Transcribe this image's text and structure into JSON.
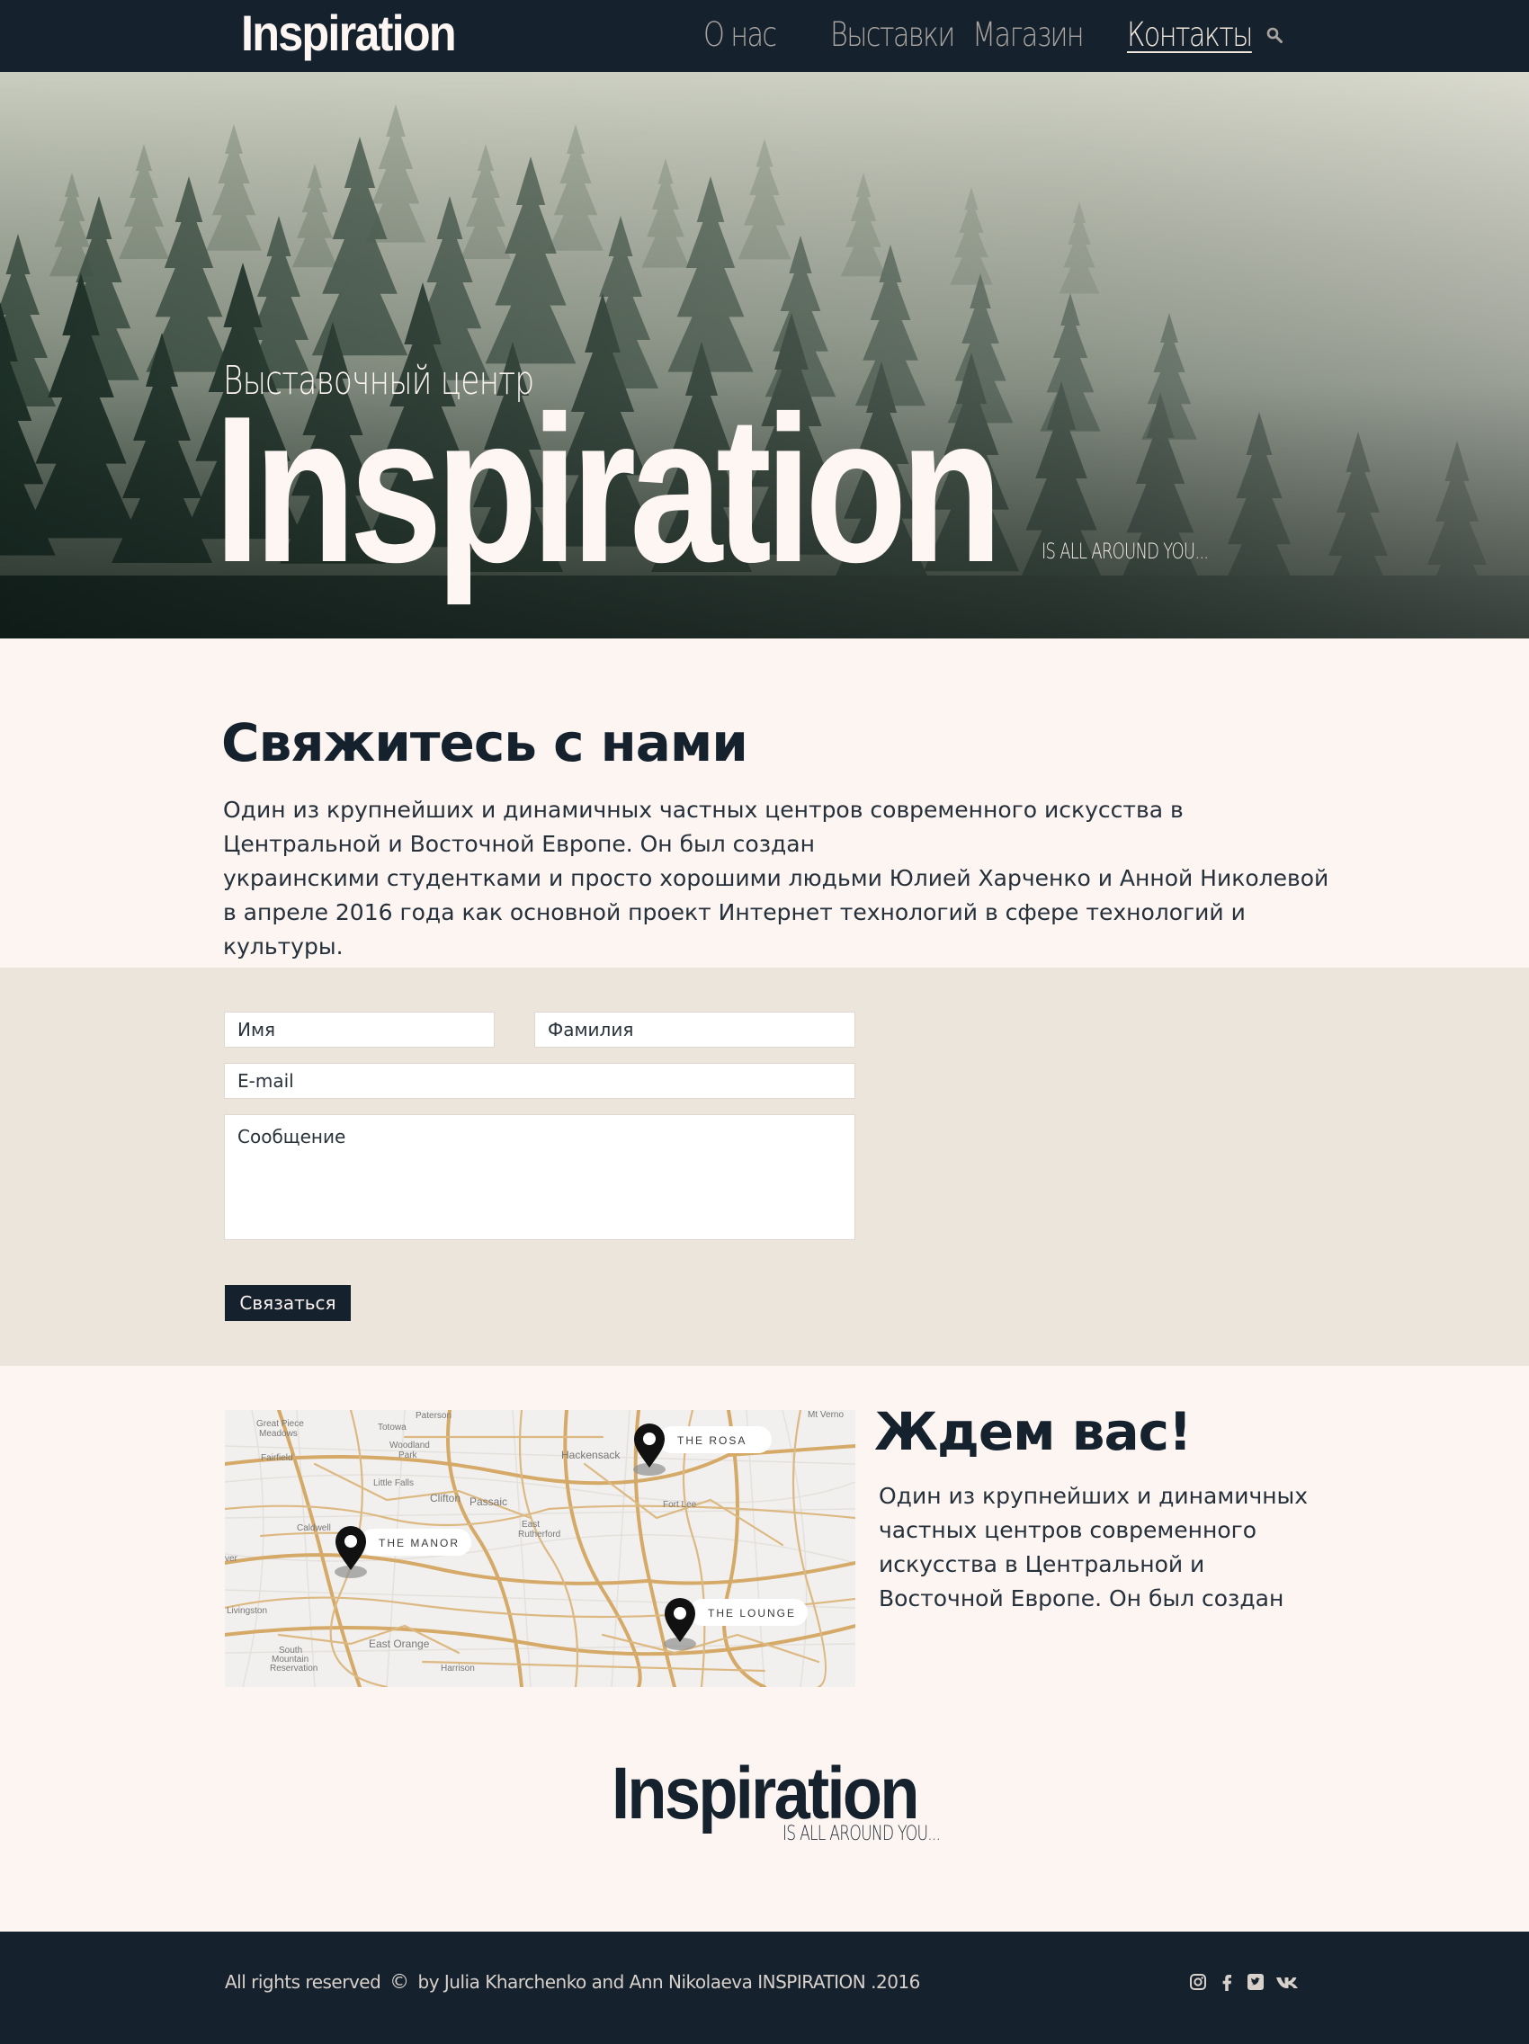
{
  "header": {
    "logo": "Inspiration",
    "nav": [
      {
        "label": "О нас",
        "active": false
      },
      {
        "label": "Выставки",
        "active": false
      },
      {
        "label": "Магазин",
        "active": false
      },
      {
        "label": "Контакты",
        "active": true
      }
    ],
    "search_icon": "search-icon"
  },
  "hero": {
    "subtitle": "Выставочный центр",
    "title": "Inspiration",
    "tagline": "IS ALL AROUND YOU..."
  },
  "contact": {
    "heading": "Свяжитесь с нами",
    "text_line1": "Один из крупнейших и динамичных частных центров современного искусства в Центральной и Восточной Европе. Он был создан",
    "text_line2": "украинскими студентками и просто хорошими людьми Юлией Харченко и Анной Николевой в апреле 2016 года как основной проект Интернет технологий в сфере технологий и культуры."
  },
  "form": {
    "first_name_placeholder": "Имя",
    "last_name_placeholder": "Фамилия",
    "email_placeholder": "E-mail",
    "message_placeholder": "Сообщение",
    "submit_label": "Связаться"
  },
  "map": {
    "pins": [
      "THE ROSA",
      "THE MANOR",
      "THE LOUNGE"
    ],
    "places": [
      "Great Piece Meadows",
      "Totowa",
      "Woodland Park",
      "Fairfield",
      "Little Falls",
      "Clifton",
      "Passaic",
      "Hackensack",
      "Caldwell",
      "East Rutherford",
      "Fort Lee",
      "Livingston",
      "East Orange",
      "South Mountain Reservation",
      "Harrison",
      "Mt Verno",
      "Paterson",
      "ver"
    ],
    "road_color": "#d5aa68"
  },
  "wait": {
    "heading": "Ждем вас!",
    "text": "Один из крупнейших и динамичных частных центров современного искусства в Центральной и Восточной Европе. Он был создан"
  },
  "footer_logo": {
    "title": "Inspiration",
    "tagline": "IS ALL AROUND YOU..."
  },
  "footer": {
    "copyright_prefix": "All rights reserved",
    "copyright_symbol": "©",
    "copyright_suffix": "by Julia Kharchenko and Ann Nikolaeva  INSPIRATION .2016",
    "social": [
      "instagram-icon",
      "facebook-icon",
      "twitter-icon",
      "vk-icon"
    ]
  },
  "colors": {
    "dark": "#15212c",
    "cream": "#fcf5f2",
    "band": "#ece5dc"
  }
}
